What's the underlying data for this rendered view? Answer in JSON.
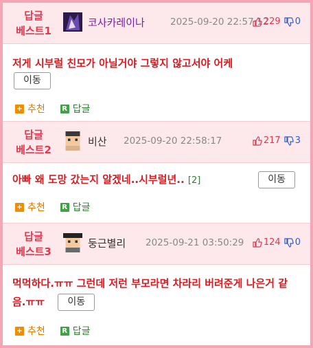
{
  "comments": [
    {
      "rank": "답글\n베스트1",
      "nick": "코사카레이나",
      "date": "2025-09-20 22:57:12",
      "up": "229",
      "down": "0",
      "text": "저게 시부럴 친모가 아닐거야 그렇지 않고서야 어케",
      "move": "이동",
      "recommend": "추천",
      "reply": "답글"
    },
    {
      "rank": "답글\n베스트2",
      "nick": "비산",
      "date": "2025-09-20 22:58:17",
      "up": "217",
      "down": "3",
      "text": "아빠 왜 도망 갔는지 알겠네..시부럴년..",
      "replies": "[2]",
      "move": "이동",
      "recommend": "추천",
      "reply": "답글"
    },
    {
      "rank": "답글\n베스트3",
      "nick": "둥근별리",
      "date": "2025-09-21 03:50:29",
      "up": "124",
      "down": "0",
      "text": "먹먹하다.ㅠㅠ 그런데 저런 부모라면 차라리 버려준게 나은거 같음.ㅠㅠ",
      "move": "이동",
      "recommend": "추천",
      "reply": "답글"
    }
  ],
  "colors": {
    "accent": "#e0384f",
    "border": "#f4a6b4",
    "header_bg": "#fde9ec",
    "up": "#e0384f",
    "down": "#2a5bd7"
  }
}
